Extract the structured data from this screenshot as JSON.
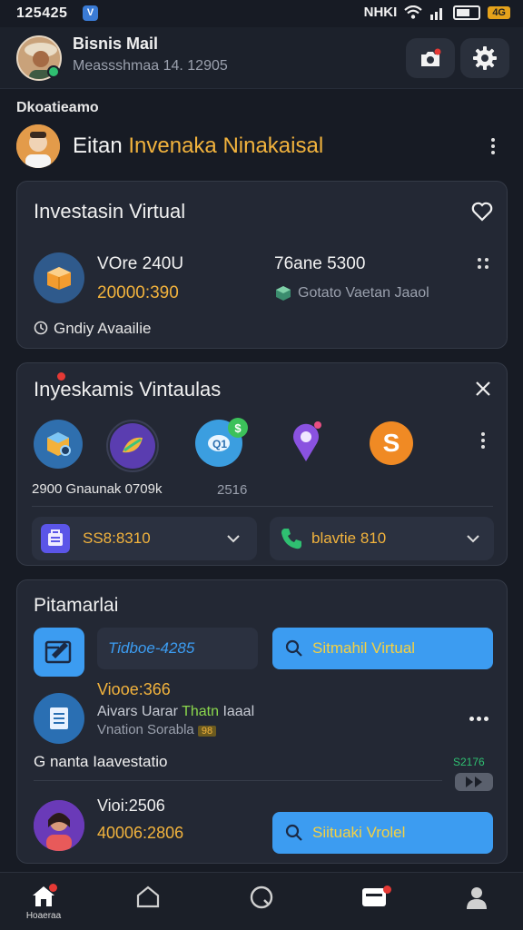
{
  "status_bar": {
    "time": "125425",
    "badge": "V",
    "indicators": "NHKI",
    "batt_label": "4G"
  },
  "header": {
    "name": "Bisnis Mail",
    "subtitle": "Meassshmaa 14. 12905",
    "icons": [
      "avatar",
      "camera-notification-icon",
      "gear-icon"
    ]
  },
  "featured": {
    "section_label": "Dkoatieamo",
    "title_white": "Eitan",
    "title_highlight": "Invenaka Ninakaisal"
  },
  "card1": {
    "title": "Investasin Virtual",
    "left_title": "VOre 240U",
    "left_value": "20000:390",
    "right_title": "76ane 5300",
    "right_sub": "Gotato Vaetan Jaaol",
    "footer": "Gndiy Avaailie"
  },
  "card2": {
    "title": "Inyeskamis Vintaulas",
    "caption_left": "2900 Gnaunak 0709k",
    "caption_right": "2516",
    "chip_left": "SS8:8310",
    "chip_right": "blavtie 810"
  },
  "card3": {
    "title": "Pitamarlai",
    "input_value": "Tidboe-4285",
    "button_primary": "Sitmahil Virtual",
    "item_title": "Viooe:366",
    "item_line1_a": "Aivars Uarar",
    "item_line1_b": "Thatn",
    "item_line1_c": "Iaaal",
    "item_line2": "Vnation Sorabla",
    "item_badge": "98",
    "row_label": "G nanta Iaavestatio",
    "row_value": "S2176",
    "bottom_title": "Vioi:2506",
    "bottom_value": "40006:2806",
    "button_secondary": "Siituaki Vrolel"
  },
  "navbar": {
    "home_label": "Hoaeraa"
  },
  "colors": {
    "background": "#171b24",
    "card": "#232834",
    "accent_blue": "#3c9cf1",
    "accent_yellow": "#f2b33d",
    "accent_green": "#8bd84d"
  }
}
